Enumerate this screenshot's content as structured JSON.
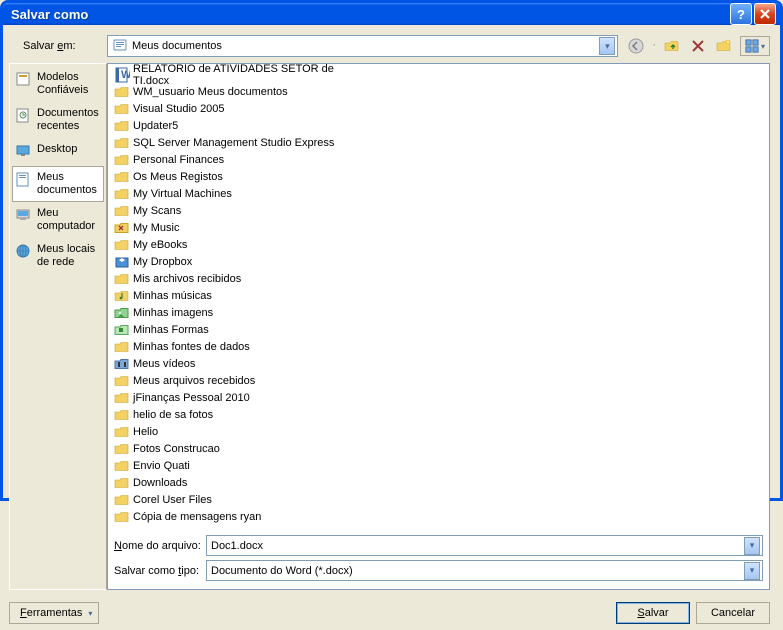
{
  "title": "Salvar como",
  "saveInLabel": "Salvar em:",
  "saveInLabelAccel": "e",
  "currentLocation": "Meus documentos",
  "toolbar": {
    "back": "back-icon",
    "up": "up-folder-icon",
    "delete": "delete-icon",
    "newfolder": "new-folder-icon",
    "views": "views-icon"
  },
  "places": [
    {
      "label": "Modelos Confiáveis",
      "icon": "templates"
    },
    {
      "label": "Documentos recentes",
      "icon": "recent"
    },
    {
      "label": "Desktop",
      "icon": "desktop"
    },
    {
      "label": "Meus documentos",
      "icon": "mydocs",
      "selected": true
    },
    {
      "label": "Meu computador",
      "icon": "mycomputer"
    },
    {
      "label": "Meus locais de rede",
      "icon": "network"
    }
  ],
  "files": [
    {
      "name": "RELATORIO de  ATIVIDADES SETOR de  TI.docx",
      "icon": "word"
    },
    {
      "name": "WM_usuario Meus documentos",
      "icon": "folder"
    },
    {
      "name": "Visual Studio 2005",
      "icon": "folder"
    },
    {
      "name": "Updater5",
      "icon": "folder"
    },
    {
      "name": "SQL Server Management Studio Express",
      "icon": "folder"
    },
    {
      "name": "Personal Finances",
      "icon": "folder"
    },
    {
      "name": "Os Meus Registos",
      "icon": "folder"
    },
    {
      "name": "My Virtual Machines",
      "icon": "folder"
    },
    {
      "name": "My Scans",
      "icon": "folder"
    },
    {
      "name": "My Music",
      "icon": "folderx"
    },
    {
      "name": "My eBooks",
      "icon": "folder"
    },
    {
      "name": "My Dropbox",
      "icon": "dropbox"
    },
    {
      "name": "Mis archivos recibidos",
      "icon": "folder"
    },
    {
      "name": "Minhas músicas",
      "icon": "music"
    },
    {
      "name": "Minhas imagens",
      "icon": "pictures"
    },
    {
      "name": "Minhas Formas",
      "icon": "shapes"
    },
    {
      "name": "Minhas fontes de dados",
      "icon": "folder"
    },
    {
      "name": "Meus vídeos",
      "icon": "videos"
    },
    {
      "name": "Meus arquivos recebidos",
      "icon": "folder"
    },
    {
      "name": "jFinanças Pessoal 2010",
      "icon": "folder"
    },
    {
      "name": "helio de sa fotos",
      "icon": "folder"
    },
    {
      "name": "Helio",
      "icon": "folder"
    },
    {
      "name": "Fotos Construcao",
      "icon": "folder"
    },
    {
      "name": "Envio Quati",
      "icon": "folder"
    },
    {
      "name": "Downloads",
      "icon": "folder"
    },
    {
      "name": "Corel User Files",
      "icon": "folder"
    },
    {
      "name": "Cópia de mensagens ryan",
      "icon": "folder"
    }
  ],
  "fileNameLabel": "Nome do arquivo:",
  "fileNameAccel": "N",
  "fileName": "Doc1.docx",
  "fileTypeLabel": "Salvar como tipo:",
  "fileTypeAccel": "t",
  "fileType": "Documento do Word (*.docx)",
  "toolsLabel": "Ferramentas",
  "toolsAccel": "F",
  "saveLabel": "Salvar",
  "saveAccel": "S",
  "cancelLabel": "Cancelar"
}
